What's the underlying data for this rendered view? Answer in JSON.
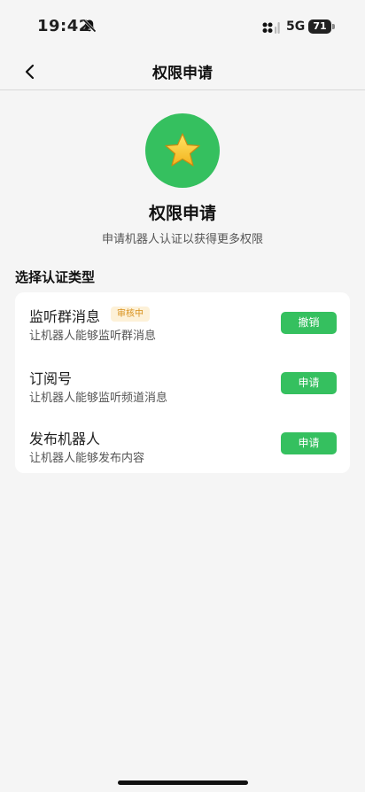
{
  "status_bar": {
    "time": "19:42",
    "network": "5G",
    "battery": "71",
    "icons": [
      "bell-off-icon",
      "signal-icon",
      "battery-icon"
    ]
  },
  "nav": {
    "title": "权限申请",
    "back_icon": "chevron-left-icon"
  },
  "hero": {
    "icon": "star-icon",
    "title": "权限申请",
    "subtitle": "申请机器人认证以获得更多权限"
  },
  "section_title": "选择认证类型",
  "permissions": [
    {
      "title": "监听群消息",
      "badge": "审核中",
      "description": "让机器人能够监听群消息",
      "action": "撤销"
    },
    {
      "title": "订阅号",
      "description": "让机器人能够监听频道消息",
      "action": "申请"
    },
    {
      "title": "发布机器人",
      "description": "让机器人能够发布内容",
      "action": "申请"
    }
  ],
  "colors": {
    "accent_green": "#35c05f",
    "badge_text": "#d8901a",
    "badge_bg": "#fdf1d8",
    "page_bg": "#f5f5f5"
  }
}
